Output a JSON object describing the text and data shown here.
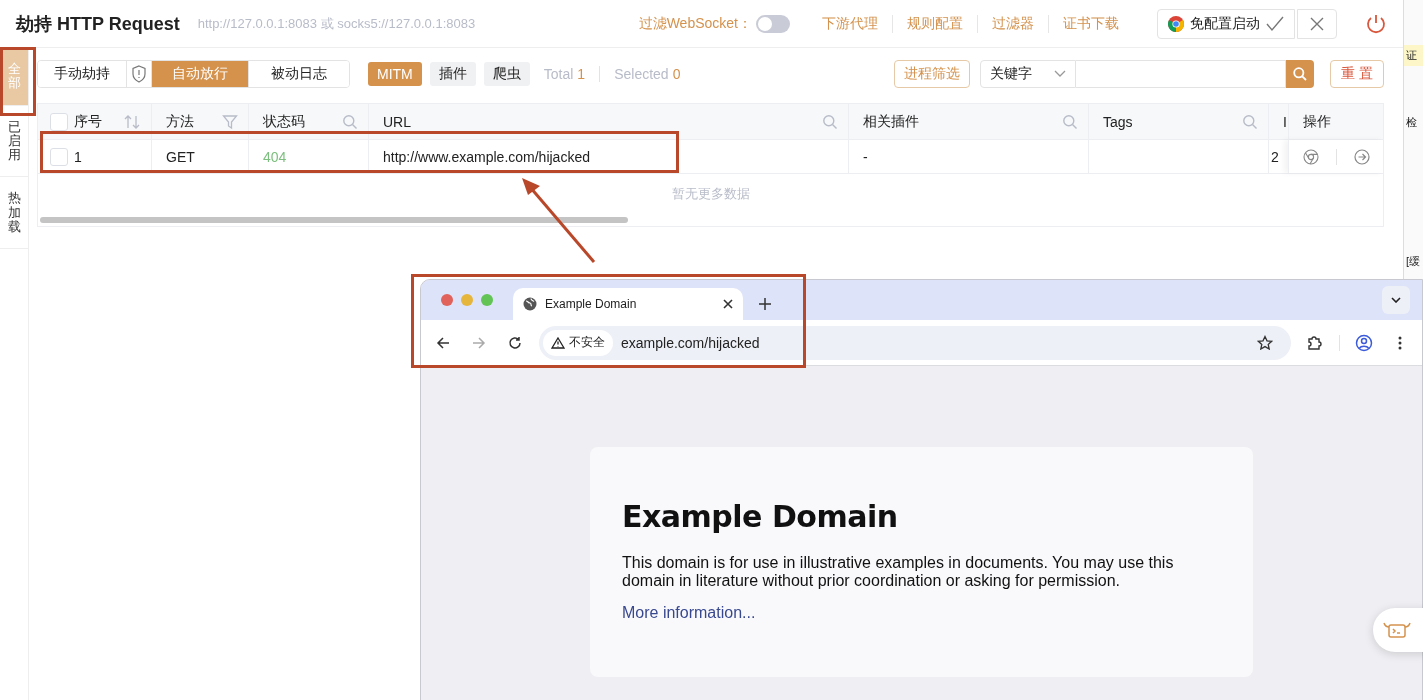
{
  "header": {
    "title": "劫持 HTTP Request",
    "proxy_address": "http://127.0.0.1:8083 或 socks5://127.0.0.1:8083",
    "websocket_filter": {
      "label": "过滤WebSocket：",
      "on": false
    },
    "links": [
      "下游代理",
      "规则配置",
      "过滤器",
      "证书下载"
    ],
    "launch_button": "免配置启动"
  },
  "side_tabs": [
    {
      "label": "全部",
      "selected": true
    },
    {
      "label": "已启用",
      "selected": false
    },
    {
      "label": "热加载",
      "selected": false
    }
  ],
  "mode_tabs": [
    {
      "label": "手动劫持",
      "selected": false
    },
    {
      "label": "自动放行",
      "selected": true
    },
    {
      "label": "被动日志",
      "selected": false
    }
  ],
  "source_tags": [
    {
      "label": "MITM",
      "selected": true
    },
    {
      "label": "插件",
      "selected": false
    },
    {
      "label": "爬虫",
      "selected": false
    }
  ],
  "total": {
    "label": "Total",
    "value": "1"
  },
  "selected_count": {
    "label": "Selected",
    "value": "0"
  },
  "process_filter": "进程筛选",
  "search": {
    "field": "关键字"
  },
  "reset": "重 置",
  "table": {
    "header_checked": false,
    "columns": [
      {
        "label": "序号",
        "kind": "sort"
      },
      {
        "label": "方法",
        "kind": "filter"
      },
      {
        "label": "状态码",
        "kind": "search"
      },
      {
        "label": "URL",
        "kind": "search"
      },
      {
        "label": "相关插件",
        "kind": "search"
      },
      {
        "label": "Tags",
        "kind": "search"
      },
      {
        "label": "I",
        "kind": "plain"
      },
      {
        "label": "操作",
        "kind": "plain"
      }
    ],
    "rows": [
      {
        "checked": false,
        "cells": [
          "1",
          "GET",
          "404",
          "http://www.example.com/hijacked",
          "-",
          "",
          "2"
        ]
      }
    ],
    "empty_note": "暂无更多数据"
  },
  "browser": {
    "tab_title": "Example Domain",
    "security_label": "不安全",
    "url": "example.com/hijacked",
    "page": {
      "heading": "Example Domain",
      "body": "This domain is for use in illustrative examples in documents. You may use this domain in literature without prior coordination or asking for permission.",
      "link": "More information..."
    }
  },
  "right_strip": [
    "证",
    "检",
    "[缓"
  ]
}
